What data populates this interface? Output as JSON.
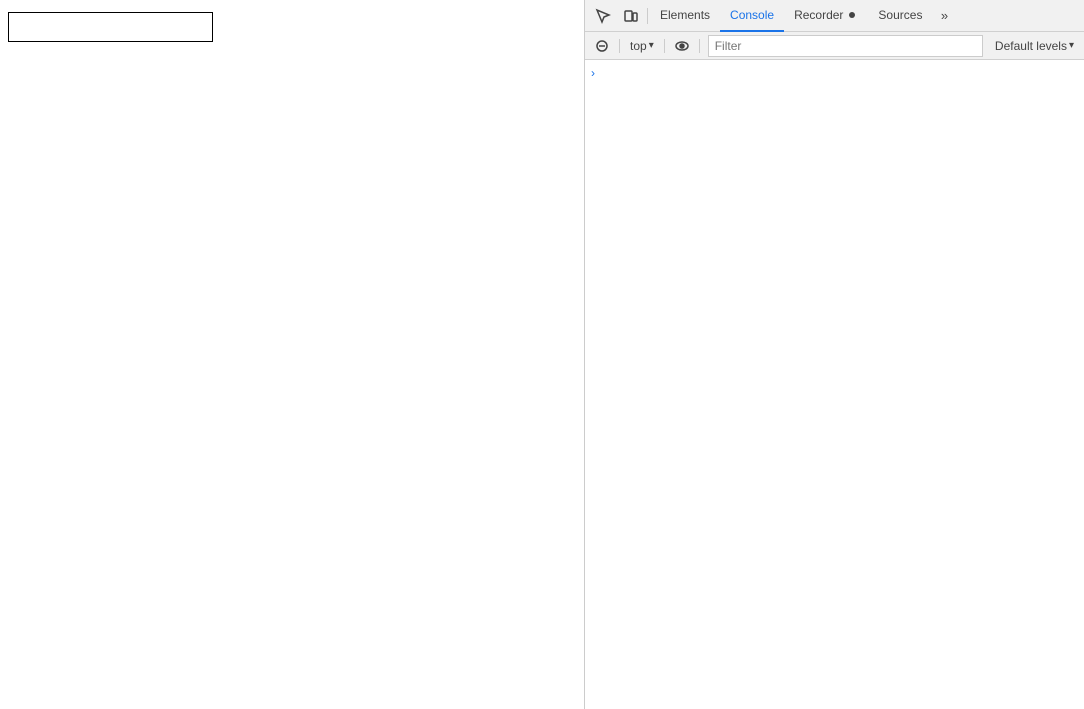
{
  "page": {
    "input_placeholder": ""
  },
  "devtools": {
    "tabs": [
      {
        "id": "elements",
        "label": "Elements",
        "active": false
      },
      {
        "id": "console",
        "label": "Console",
        "active": true
      },
      {
        "id": "recorder",
        "label": "Recorder",
        "active": false
      },
      {
        "id": "sources",
        "label": "Sources",
        "active": false
      }
    ],
    "more_tabs_label": "»",
    "console_bar": {
      "context_label": "top",
      "context_arrow": "▾",
      "filter_placeholder": "Filter",
      "default_levels_label": "Default levels",
      "default_levels_arrow": "▾"
    },
    "console_chevron": "›"
  }
}
